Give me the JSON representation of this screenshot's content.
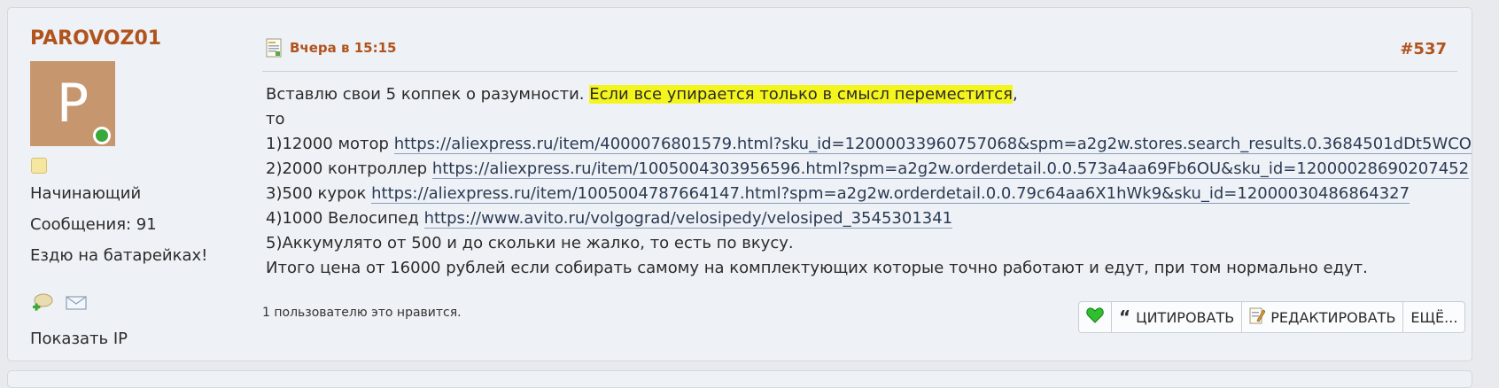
{
  "user": {
    "name": "PAROVOZ01",
    "avatar_letter": "P",
    "rank": "Начинающий",
    "messages": "Сообщения: 91",
    "status": "Ездю на батарейках!",
    "show_ip": "Показать IP"
  },
  "post": {
    "time": "Вчера в 15:15",
    "number": "#537",
    "line1_a": "Вставлю свои 5 коппек о разумности. ",
    "line1_highlight": "Если все упирается только в смысл переместится",
    "line1_b": ",",
    "line2": "то",
    "items": [
      {
        "prefix": "1)12000 мотор ",
        "link": "https://aliexpress.ru/item/4000076801579.html?sku_id=12000033960757068&spm=a2g2w.stores.search_results.0.3684501dDt5WCO"
      },
      {
        "prefix": "2)2000 контроллер ",
        "link": "https://aliexpress.ru/item/1005004303956596.html?spm=a2g2w.orderdetail.0.0.573a4aa69Fb6OU&sku_id=12000028690207452"
      },
      {
        "prefix": "3)500 курок ",
        "link": "https://aliexpress.ru/item/1005004787664147.html?spm=a2g2w.orderdetail.0.0.79c64aa6X1hWk9&sku_id=12000030486864327"
      },
      {
        "prefix": "4)1000 Велосипед ",
        "link": "https://www.avito.ru/volgograd/velosipedy/velosiped_3545301341"
      }
    ],
    "line7": "5)Аккумулято от 500 и до скольки не жалко, то есть по вкусу.",
    "line8": "Итого цена от 16000 рублей если собирать самому на комплектующих которые точно работают и едут, при том нормально едут.",
    "likes": "1 пользователю это нравится."
  },
  "actions": {
    "quote": "ЦИТИРОВАТЬ",
    "edit": "РЕДАКТИРОВАТЬ",
    "more": "ЕЩЁ..."
  },
  "colors": {
    "accent": "#b1531c",
    "highlight": "#f5f51e",
    "online": "#3aa83a"
  }
}
